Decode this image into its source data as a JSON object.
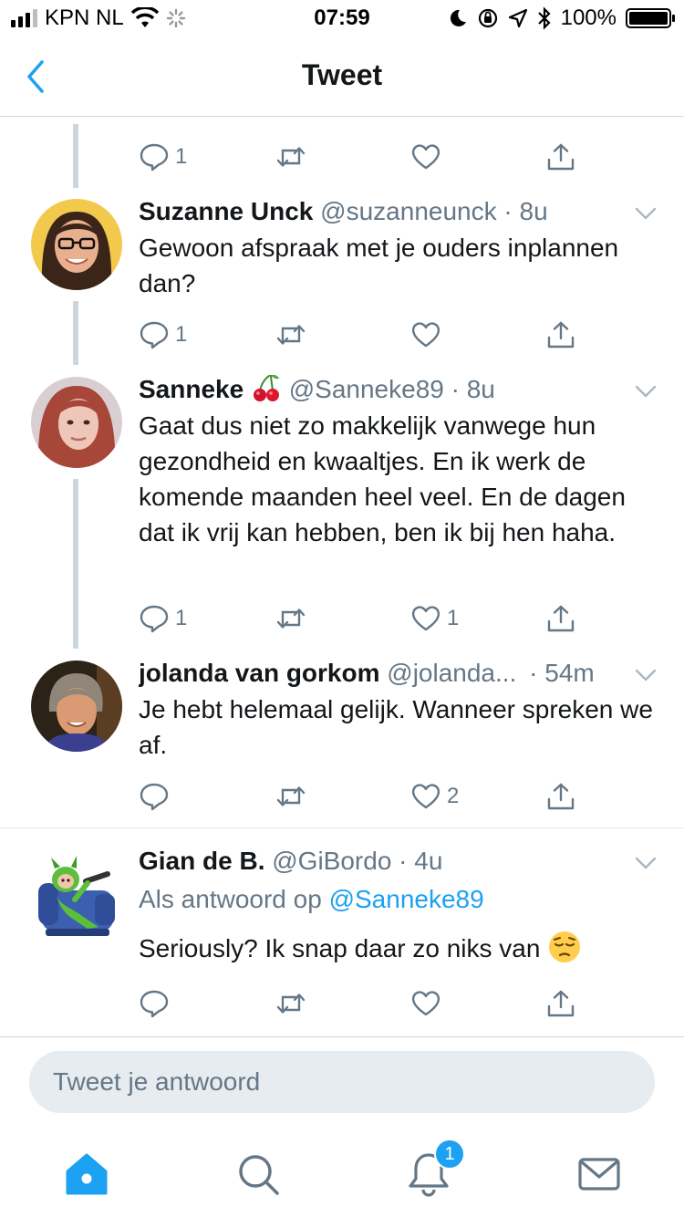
{
  "status_bar": {
    "carrier": "KPN NL",
    "time": "07:59",
    "battery": "100%",
    "battery_level": 1.0
  },
  "header": {
    "title": "Tweet",
    "back_icon": "chevron-left-icon"
  },
  "top_actions": {
    "reply_count": "1",
    "retweet_count": "",
    "like_count": ""
  },
  "tweets": [
    {
      "name": "Suzanne Unck",
      "handle": "@suzanneunck",
      "time": "· 8u",
      "text": "Gewoon afspraak met je ouders inplannen dan?",
      "reply_count": "1",
      "retweet_count": "",
      "like_count": ""
    },
    {
      "name": "Sanneke",
      "handle": "@Sanneke89",
      "time": "· 8u",
      "emoji": "cherries",
      "text": "Gaat dus niet zo makkelijk vanwege hun gezondheid en kwaaltjes. En ik werk de komende maanden heel veel. En de dagen dat ik vrij kan hebben, ben ik bij hen haha.",
      "reply_count": "1",
      "retweet_count": "",
      "like_count": "1"
    },
    {
      "name": "jolanda van gorkom",
      "handle": "@jolanda...",
      "time": "· 54m",
      "text": "Je hebt helemaal gelijk. Wanneer spreken we af.",
      "reply_count": "",
      "retweet_count": "",
      "like_count": "2"
    },
    {
      "name": "Gian de B.",
      "handle": "@GiBordo",
      "time": "· 4u",
      "reply_prefix": "Als antwoord op",
      "reply_mention": "@Sanneke89",
      "text": "Seriously? Ik snap daar zo niks van",
      "emoji": "pensive-face",
      "reply_count": "",
      "retweet_count": "",
      "like_count": ""
    }
  ],
  "reply_box": {
    "placeholder": "Tweet je antwoord"
  },
  "tab_bar": {
    "notifications_badge": "1",
    "icons": [
      "home-icon",
      "search-icon",
      "notifications-icon",
      "messages-icon"
    ]
  },
  "colors": {
    "accent": "#1da1f2",
    "text": "#14171a",
    "secondary": "#657786",
    "thread_line": "#ccd6dd"
  }
}
